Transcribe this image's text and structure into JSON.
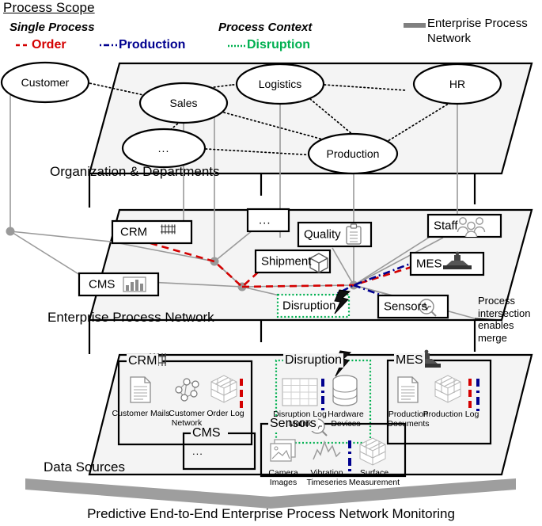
{
  "legend": {
    "title": "Process Scope",
    "single_process": "Single Process",
    "order": "Order",
    "production": "Production",
    "process_context": "Process Context",
    "disruption": "Disruption",
    "enterprise_process_network": "Enterprise Process Network",
    "colors": {
      "order": "#d40000",
      "production": "#00008f",
      "disruption": "#00b050",
      "network": "#808080"
    }
  },
  "planes": {
    "organization": "Organization & Departments",
    "enterprise": "Enterprise Process Network",
    "data_sources": "Data Sources"
  },
  "organization_nodes": [
    {
      "label": "Customer"
    },
    {
      "label": "Sales"
    },
    {
      "label": "..."
    },
    {
      "label": "Logistics"
    },
    {
      "label": "Production"
    },
    {
      "label": "HR"
    }
  ],
  "enterprise_nodes": [
    {
      "label": "CRM",
      "icon": "server-rack-icon"
    },
    {
      "label": "CMS",
      "icon": "bar-chart-icon"
    },
    {
      "label": "...",
      "icon": "none"
    },
    {
      "label": "Quality",
      "icon": "clipboard-checklist-icon"
    },
    {
      "label": "Shipment",
      "icon": "package-box-icon"
    },
    {
      "label": "Staff",
      "icon": "people-group-icon"
    },
    {
      "label": "MES",
      "icon": "machine-icon"
    },
    {
      "label": "Disruption",
      "icon": "lightning-bolt-icon"
    },
    {
      "label": "Sensors",
      "icon": "signal-magnifier-icon"
    }
  ],
  "note": "Process intersection enables merge",
  "data_sources": {
    "crm": {
      "title": "CRM",
      "icon": "server-rack-icon",
      "items": [
        {
          "caption": "Customer Mails",
          "icon": "document-icon",
          "marker": "order"
        },
        {
          "caption": "Customer Network",
          "icon": "graph-network-icon",
          "marker": "none"
        },
        {
          "caption": "Order Log",
          "icon": "cube-stack-icon",
          "marker": "order"
        }
      ]
    },
    "disruption": {
      "title": "Disruption",
      "icon": "lightning-bolt-icon",
      "items": [
        {
          "caption": "Disruption Log Matrix",
          "icon": "matrix-grid-icon",
          "marker": "production"
        },
        {
          "caption": "Hardware Devices",
          "icon": "database-icon",
          "marker": "none"
        }
      ]
    },
    "mes": {
      "title": "MES",
      "icon": "machine-icon",
      "items": [
        {
          "caption": "Production Documents",
          "icon": "document-icon",
          "marker": "both"
        },
        {
          "caption": "Production Log",
          "icon": "cube-stack-icon",
          "marker": "both"
        }
      ]
    },
    "cms": {
      "title": "CMS",
      "icon": "none",
      "items": [
        {
          "caption": "...",
          "icon": "none",
          "marker": "none"
        }
      ]
    },
    "sensors": {
      "title": "Sensors",
      "icon": "signal-magnifier-icon",
      "items": [
        {
          "caption": "Camera Images",
          "icon": "photo-stack-icon",
          "marker": "none"
        },
        {
          "caption": "Vibration Timeseries",
          "icon": "timeseries-icon",
          "marker": "production"
        },
        {
          "caption": "Surface Measurement",
          "icon": "cube-stack-icon",
          "marker": "none"
        }
      ]
    }
  },
  "bottom_caption": "Predictive End-to-End Enterprise Process Network Monitoring"
}
